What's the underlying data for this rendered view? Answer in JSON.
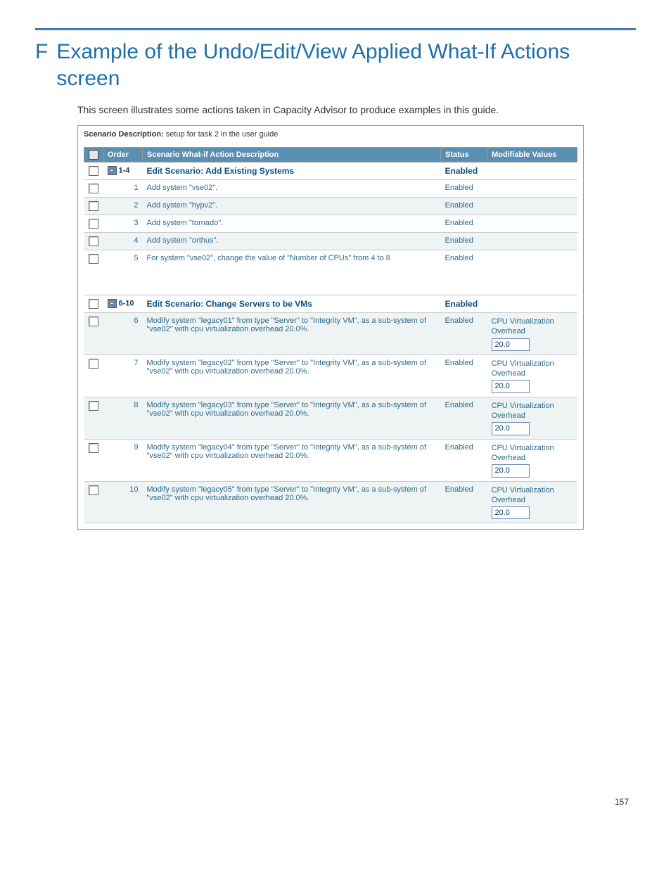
{
  "title_letter": "F",
  "title_text": "Example of the Undo/Edit/View Applied What-If Actions screen",
  "intro": "This screen illustrates some actions taken in Capacity Advisor to produce examples in this guide.",
  "scenario_label": "Scenario Description:",
  "scenario_value": "setup for task 2 in the user guide",
  "headers": {
    "order": "Order",
    "desc": "Scenario What-if Action Description",
    "status": "Status",
    "mod": "Modifiable Values"
  },
  "group1": {
    "range": "1-4",
    "title": "Edit Scenario: Add Existing Systems",
    "status": "Enabled"
  },
  "rows_simple": [
    {
      "order": "1",
      "desc": "Add system \"vse02\".",
      "status": "Enabled"
    },
    {
      "order": "2",
      "desc": "Add system \"hypv2\".",
      "status": "Enabled"
    },
    {
      "order": "3",
      "desc": "Add system \"tornado\".",
      "status": "Enabled"
    },
    {
      "order": "4",
      "desc": "Add system \"orthus\".",
      "status": "Enabled"
    }
  ],
  "row5": {
    "order": "5",
    "desc": "For system \"vse02\", change the value of \"Number of CPUs\" from 4 to 8",
    "status": "Enabled"
  },
  "group2": {
    "range": "6-10",
    "title": "Edit Scenario: Change Servers to be VMs",
    "status": "Enabled"
  },
  "rows_mod": [
    {
      "order": "6",
      "desc": "Modify system \"legacy01\" from type \"Server\" to \"Integrity VM\", as a sub-system of \"vse02\" with cpu virtualization overhead 20.0%.",
      "status": "Enabled",
      "mod_label": "CPU Virtualization Overhead",
      "mod_val": "20.0"
    },
    {
      "order": "7",
      "desc": "Modify system \"legacy02\" from type \"Server\" to \"Integrity VM\", as a sub-system of \"vse02\" with cpu virtualization overhead 20.0%.",
      "status": "Enabled",
      "mod_label": "CPU Virtualization Overhead",
      "mod_val": "20.0"
    },
    {
      "order": "8",
      "desc": "Modify system \"legacy03\" from type \"Server\" to \"Integrity VM\", as a sub-system of \"vse02\" with cpu virtualization overhead 20.0%.",
      "status": "Enabled",
      "mod_label": "CPU Virtualization Overhead",
      "mod_val": "20.0"
    },
    {
      "order": "9",
      "desc": "Modify system \"legacy04\" from type \"Server\" to \"Integrity VM\", as a sub-system of \"vse02\" with cpu virtualization overhead 20.0%.",
      "status": "Enabled",
      "mod_label": "CPU Virtualization Overhead",
      "mod_val": "20.0"
    },
    {
      "order": "10",
      "desc": "Modify system \"legacy05\" from type \"Server\" to \"Integrity VM\", as a sub-system of \"vse02\" with cpu virtualization overhead 20.0%.",
      "status": "Enabled",
      "mod_label": "CPU Virtualization Overhead",
      "mod_val": "20.0"
    }
  ],
  "page_number": "157"
}
